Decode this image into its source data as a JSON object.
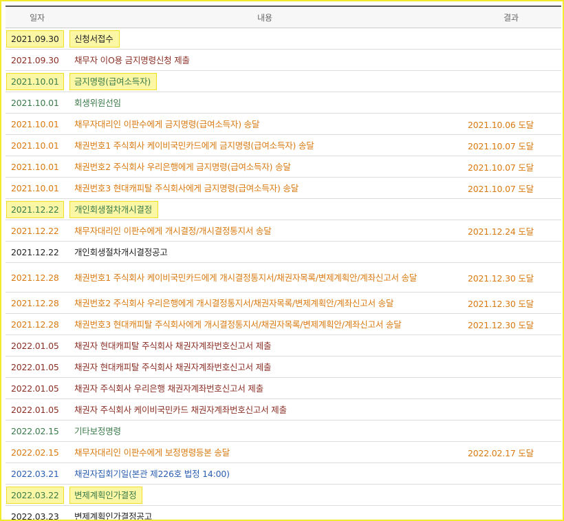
{
  "header": {
    "date": "일자",
    "content": "내용",
    "result": "결과"
  },
  "rows": [
    {
      "date": "2021.09.30",
      "content": "신청서접수",
      "result": "",
      "color": "c-black",
      "highlight": true
    },
    {
      "date": "2021.09.30",
      "content": "채무자 이O용 금지명령신청 제출",
      "result": "",
      "color": "c-brown",
      "highlight": false
    },
    {
      "date": "2021.10.01",
      "content": "금지명령(급여소득자)",
      "result": "",
      "color": "c-green",
      "highlight": true
    },
    {
      "date": "2021.10.01",
      "content": "회생위원선임",
      "result": "",
      "color": "c-green",
      "highlight": false
    },
    {
      "date": "2021.10.01",
      "content": "채무자대리인 이판수에게 금지명령(급여소득자) 송달",
      "result": "2021.10.06 도달",
      "color": "c-orange",
      "highlight": false
    },
    {
      "date": "2021.10.01",
      "content": "채권번호1 주식회사 케이비국민카드에게 금지명령(급여소득자) 송달",
      "result": "2021.10.07 도달",
      "color": "c-orange",
      "highlight": false
    },
    {
      "date": "2021.10.01",
      "content": "채권번호2 주식회사 우리은행에게 금지명령(급여소득자) 송달",
      "result": "2021.10.07 도달",
      "color": "c-orange",
      "highlight": false
    },
    {
      "date": "2021.10.01",
      "content": "채권번호3 현대캐피탈 주식회사에게 금지명령(급여소득자) 송달",
      "result": "2021.10.07 도달",
      "color": "c-orange",
      "highlight": false
    },
    {
      "date": "2021.12.22",
      "content": "개인회생절차개시결정",
      "result": "",
      "color": "c-green",
      "highlight": true
    },
    {
      "date": "2021.12.22",
      "content": "채무자대리인 이판수에게 개시결정/개시결정통지서 송달",
      "result": "2021.12.24 도달",
      "color": "c-orange",
      "highlight": false
    },
    {
      "date": "2021.12.22",
      "content": "개인회생절차개시결정공고",
      "result": "",
      "color": "c-black",
      "highlight": false
    },
    {
      "date": "2021.12.28",
      "content": "채권번호1 주식회사 케이비국민카드에게 개시결정통지서/채권자목록/변제계획안/계좌신고서 송달",
      "result": "2021.12.30 도달",
      "color": "c-orange",
      "highlight": false,
      "tall": true
    },
    {
      "date": "2021.12.28",
      "content": "채권번호2 주식회사 우리은행에게 개시결정통지서/채권자목록/변제계획안/계좌신고서 송달",
      "result": "2021.12.30 도달",
      "color": "c-orange",
      "highlight": false
    },
    {
      "date": "2021.12.28",
      "content": "채권번호3 현대캐피탈 주식회사에게 개시결정통지서/채권자목록/변제계획안/계좌신고서 송달",
      "result": "2021.12.30 도달",
      "color": "c-orange",
      "highlight": false
    },
    {
      "date": "2022.01.05",
      "content": "채권자 현대캐피탈 주식회사 채권자계좌번호신고서 제출",
      "result": "",
      "color": "c-brown",
      "highlight": false
    },
    {
      "date": "2022.01.05",
      "content": "채권자 현대캐피탈 주식회사 채권자계좌번호신고서 제출",
      "result": "",
      "color": "c-brown",
      "highlight": false
    },
    {
      "date": "2022.01.05",
      "content": "채권자 주식회사 우리은행 채권자계좌번호신고서 제출",
      "result": "",
      "color": "c-brown",
      "highlight": false
    },
    {
      "date": "2022.01.05",
      "content": "채권자 주식회사 케이비국민카드 채권자계좌번호신고서 제출",
      "result": "",
      "color": "c-brown",
      "highlight": false
    },
    {
      "date": "2022.02.15",
      "content": "기타보정명령",
      "result": "",
      "color": "c-green",
      "highlight": false
    },
    {
      "date": "2022.02.15",
      "content": "채무자대리인 이판수에게 보정명령등본 송달",
      "result": "2022.02.17 도달",
      "color": "c-orange",
      "highlight": false
    },
    {
      "date": "2022.03.21",
      "content": "채권자집회기일(본관 제226호 법정 14:00)",
      "result": "",
      "color": "c-blue",
      "highlight": false
    },
    {
      "date": "2022.03.22",
      "content": "변제계획인가결정",
      "result": "",
      "color": "c-green",
      "highlight": true
    },
    {
      "date": "2022.03.23",
      "content": "변제계획인가결정공고",
      "result": "",
      "color": "c-black",
      "highlight": false
    }
  ]
}
